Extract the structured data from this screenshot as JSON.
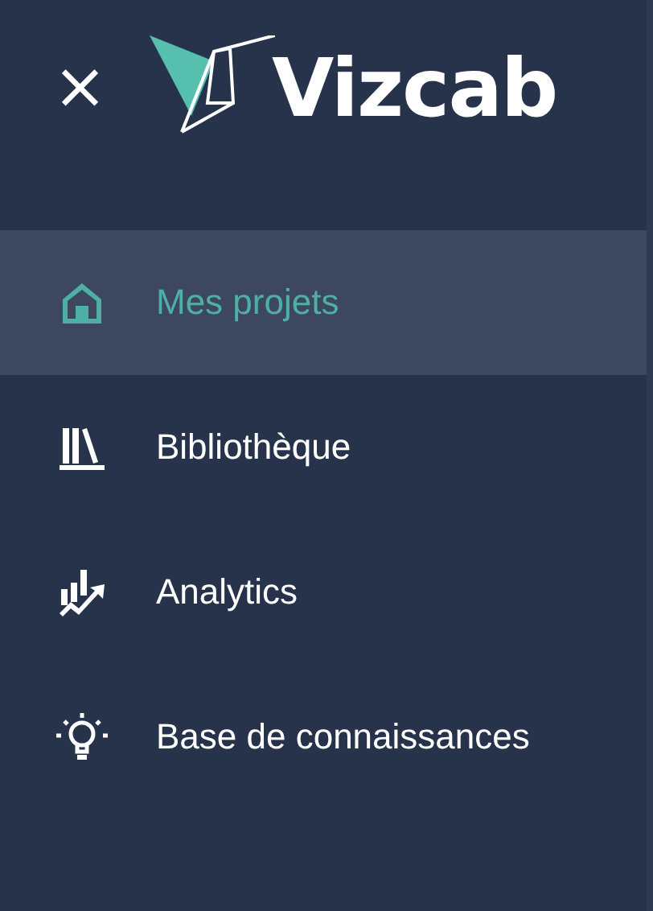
{
  "header": {
    "close": "×",
    "logo_text": "Vizcab"
  },
  "menu": [
    {
      "label": "Mes projets",
      "selected": true
    },
    {
      "label": "Bibliothèque",
      "selected": false
    },
    {
      "label": "Analytics",
      "selected": false
    },
    {
      "label": "Base de connaissances",
      "selected": false
    }
  ]
}
